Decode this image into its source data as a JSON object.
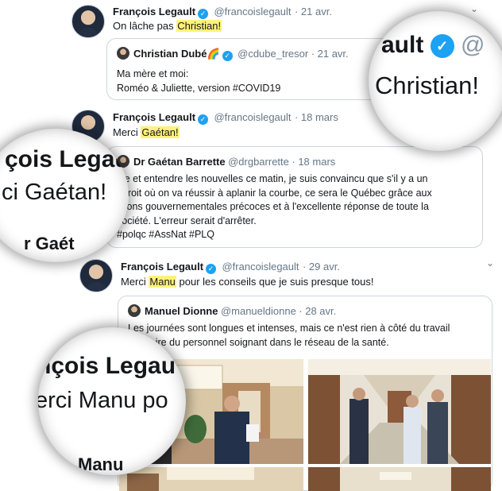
{
  "tweet1": {
    "author": "François Legault",
    "handle": "@francoislegault",
    "date": "· 21 avr.",
    "text_before": "On lâche pas ",
    "text_highlight": "Christian!",
    "quote": {
      "author": "Christian Dubé🌈",
      "handle": "@cdube_tresor",
      "date": "· 21 avr.",
      "line1": "Ma mère et moi:",
      "line2": "Roméo & Juliette, version #COVID19"
    }
  },
  "tweet2": {
    "author": "François Legault",
    "handle": "@francoislegault",
    "date": "· 18 mars",
    "text_before": "Merci ",
    "text_highlight": "Gaétan!",
    "quote": {
      "author": "Dr Gaétan Barrette",
      "handle": "@drgbarrette",
      "date": "· 18 mars",
      "line1": "lire et entendre les nouvelles ce matin, je suis convaincu que s'il y a un",
      "line2": "ndroit où on va réussir à aplanir la courbe, ce sera le Québec grâce aux",
      "line3": "ctions gouvernementales précoces et à l'excellente réponse de toute la",
      "line4": "société. L'erreur serait d'arrêter.",
      "line5": "#polqc #AssNat #PLQ"
    }
  },
  "tweet3": {
    "author": "François Legault",
    "handle": "@francoislegault",
    "date": "· 29 avr.",
    "text_highlight": "Manu",
    "text_before": "Merci ",
    "text_after": " pour les conseils que je suis presque tous!",
    "quote": {
      "author": "Manuel Dionne",
      "handle": "@manueldionne",
      "date": "· 28 avr.",
      "line1": "Les journées sont longues et intenses, mais ce n'est rien à côté du travail",
      "line2": "ordinaire du personnel soignant dans le réseau de la santé."
    }
  },
  "magnifiers": {
    "m1_line1": "ault",
    "m1_line1_suffix": "@",
    "m1_line2": "Christian!",
    "m2_line1": "çois Legau",
    "m2_line2": "ci Gaétan!",
    "m2_line3": "r Gaét",
    "m3_line1": "nçois Legau",
    "m3_line2": "erci Manu po",
    "m3_line3": "Manu"
  },
  "icons": {
    "verified": "✓",
    "chevron": "⌄"
  },
  "colors": {
    "highlight": "#fff27a",
    "verified": "#1da1f2",
    "muted": "#657786",
    "border": "#ccd6dd"
  }
}
